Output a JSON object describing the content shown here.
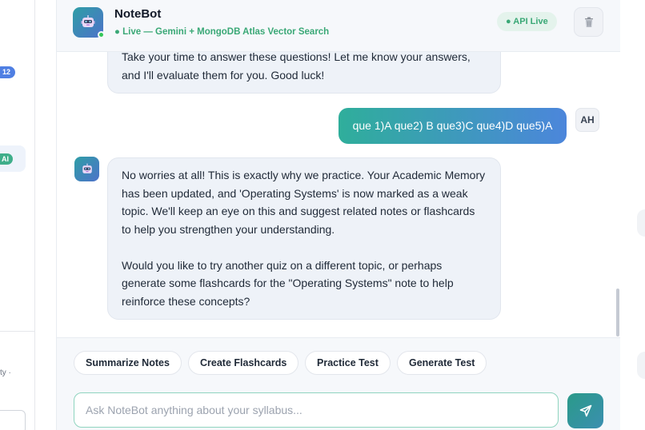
{
  "sidebar": {
    "badge_count": "12",
    "ai_badge": "AI",
    "footer_text": "ty ·"
  },
  "header": {
    "bot_name": "NoteBot",
    "status": "● Live — Gemini + MongoDB Atlas Vector Search",
    "api_status": "● API Live",
    "trash_icon": "trash-icon"
  },
  "messages": [
    {
      "role": "bot",
      "lines": [
        "Take your time to answer these questions! Let me know your answers,",
        "and I'll evaluate them for you. Good luck!"
      ]
    },
    {
      "role": "user",
      "text": "que 1)A que2) B que3)C que4)D que5)A",
      "avatar_initials": "AH"
    },
    {
      "role": "bot",
      "lines": [
        "No worries at all! This is exactly why we practice. Your Academic Memory",
        "has been updated, and 'Operating Systems' is now marked as a weak",
        "topic. We'll keep an eye on this and suggest related notes or flashcards",
        "to help you strengthen your understanding.",
        "",
        "Would you like to try another quiz on a different topic, or perhaps",
        "generate some flashcards for the \"Operating Systems\" note to help",
        "reinforce these concepts?"
      ]
    }
  ],
  "quick_actions": [
    "Summarize Notes",
    "Create Flashcards",
    "Practice Test",
    "Generate Test"
  ],
  "composer": {
    "placeholder": "Ask NoteBot anything about your syllabus...",
    "value": "",
    "send_icon": "send-icon"
  },
  "colors": {
    "accent_teal": "#2fae9b",
    "accent_blue": "#4c86db",
    "live_green": "#3aa876"
  }
}
